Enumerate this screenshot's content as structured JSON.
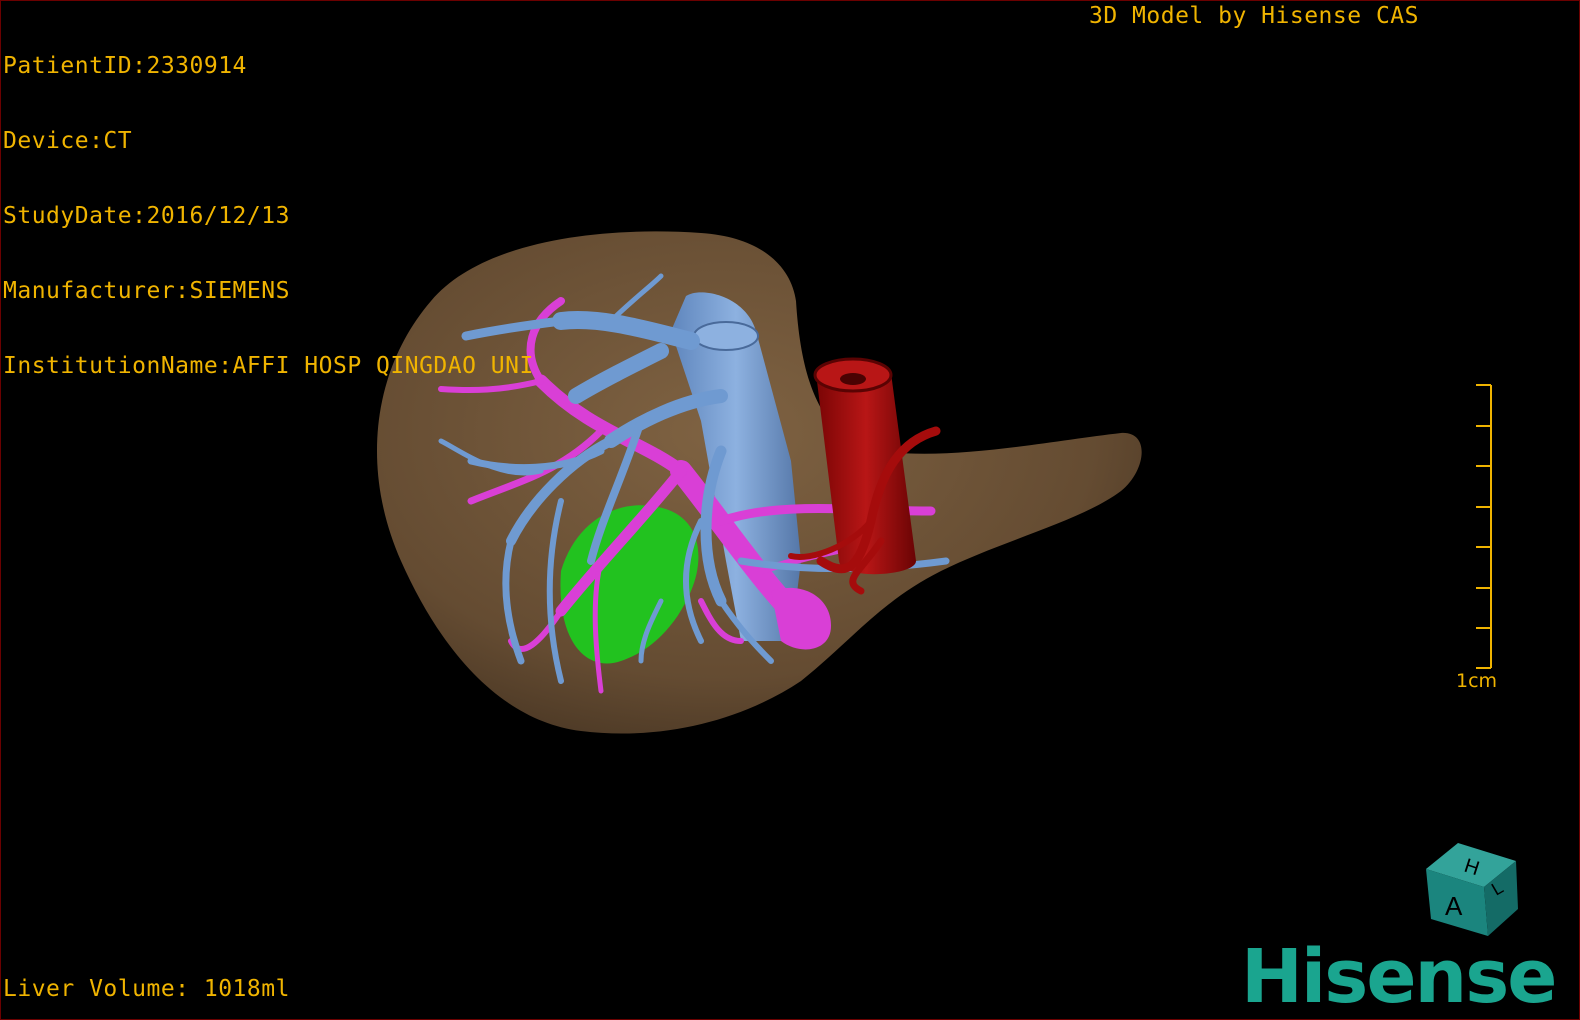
{
  "study_info": {
    "patient_id": "PatientID:2330914",
    "device": "Device:CT",
    "study_date": "StudyDate:2016/12/13",
    "manufacturer": "Manufacturer:SIEMENS",
    "institution": "InstitutionName:AFFI HOSP QINGDAO UNI"
  },
  "title": "3D Model by Hisense CAS",
  "volume_text": "Liver Volume: 1018ml",
  "scale_bar": {
    "label": "1cm"
  },
  "orientation_cube": {
    "top_label": "H",
    "front_label": "A",
    "side_label": "L"
  },
  "brand": {
    "logo_text": "Hisense",
    "color": "#1aa58f"
  },
  "colors": {
    "text": "#f0b400",
    "liver": "#7a5d3e",
    "hepatic_vein": "#6f9ad1",
    "portal_vein": "#d93fd6",
    "artery_ivc": "#a50c0c",
    "tumor": "#22c21f",
    "background": "#000000"
  }
}
